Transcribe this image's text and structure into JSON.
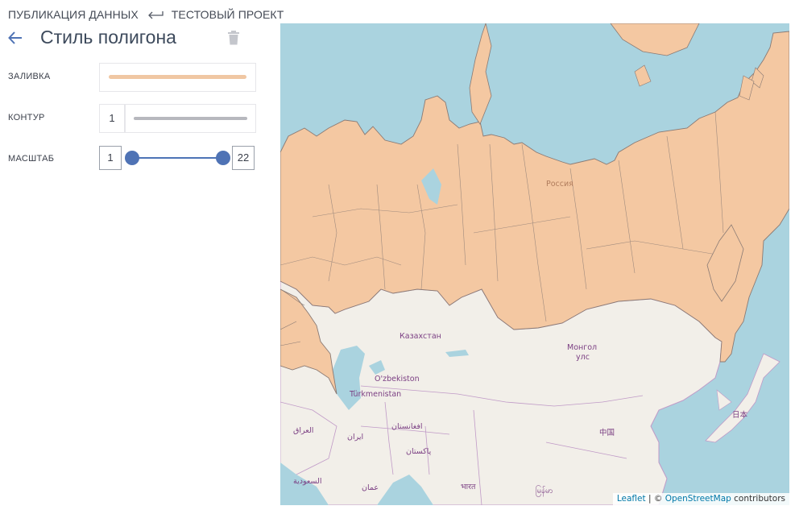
{
  "breadcrumb": {
    "section": "ПУБЛИКАЦИЯ ДАННЫХ",
    "project": "ТЕСТОВЫЙ ПРОЕКТ"
  },
  "header": {
    "title": "Стиль полигона"
  },
  "fields": {
    "fill_label": "ЗАЛИВКА",
    "fill_color": "#f0c7a3",
    "outline_label": "КОНТУР",
    "outline_width": "1",
    "outline_color": "#b7b8be",
    "scale_label": "МАСШТАБ",
    "scale_min": "1",
    "scale_max": "22"
  },
  "map": {
    "labels": {
      "russia": "Россия",
      "kazakhstan": "Казахстан",
      "mongolia_1": "Монгол",
      "mongolia_2": "улс",
      "uzbekistan": "O'zbekiston",
      "turkmenistan": "Türkmenistan",
      "afghanistan": "افغانستان",
      "iraq": "العراق",
      "iran": "ایران",
      "pakistan": "پاکستان",
      "china": "中国",
      "japan": "日本",
      "saudi": "السعودية",
      "oman": "عمان",
      "india": "भारत",
      "myanmar": "မြန်မာ"
    },
    "attribution": {
      "leaflet": "Leaflet",
      "sep": " | © ",
      "osm": "OpenStreetMap",
      "contrib": " contributors"
    },
    "colors": {
      "water": "#aad3df",
      "land": "#f2efe9",
      "region_fill": "#f4c8a2",
      "border": "#c09ac7",
      "region_border": "#8a7a74"
    }
  }
}
